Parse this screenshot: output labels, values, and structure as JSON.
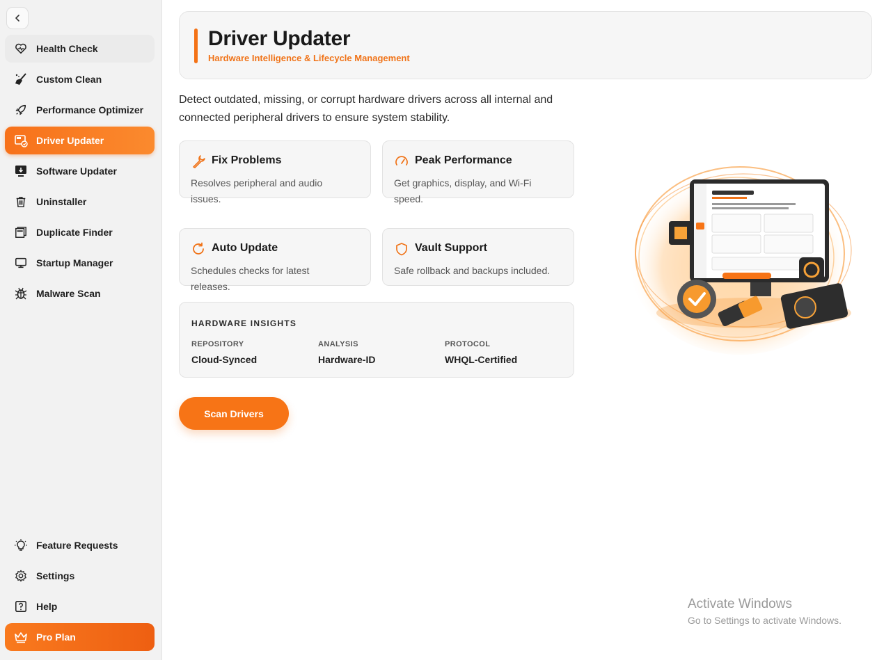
{
  "sidebar": {
    "top_items": [
      {
        "label": "Health Check",
        "icon": "heart-icon"
      },
      {
        "label": "Custom Clean",
        "icon": "broom-icon"
      },
      {
        "label": "Performance Optimizer",
        "icon": "rocket-icon"
      },
      {
        "label": "Driver Updater",
        "icon": "driver-icon",
        "active": true
      },
      {
        "label": "Software Updater",
        "icon": "monitor-download-icon"
      },
      {
        "label": "Uninstaller",
        "icon": "trash-icon"
      },
      {
        "label": "Duplicate Finder",
        "icon": "duplicate-icon"
      },
      {
        "label": "Startup Manager",
        "icon": "monitor-icon"
      },
      {
        "label": "Malware Scan",
        "icon": "bug-icon"
      }
    ],
    "bottom_items": [
      {
        "label": "Feature Requests",
        "icon": "lightbulb-icon"
      },
      {
        "label": "Settings",
        "icon": "gear-icon"
      },
      {
        "label": "Help",
        "icon": "help-icon"
      },
      {
        "label": "Pro Plan",
        "icon": "crown-icon"
      }
    ]
  },
  "header": {
    "title": "Driver Updater",
    "subtitle": "Hardware Intelligence & Lifecycle Management"
  },
  "description": "Detect outdated, missing, or corrupt hardware drivers across all internal and connected peripheral drivers to ensure system stability.",
  "features": [
    {
      "title": "Fix Problems",
      "desc": "Resolves peripheral and audio issues.",
      "icon": "wrench-icon"
    },
    {
      "title": "Peak Performance",
      "desc": "Get graphics, display, and Wi-Fi speed.",
      "icon": "gauge-icon"
    },
    {
      "title": "Auto Update",
      "desc": "Schedules checks for latest releases.",
      "icon": "refresh-icon"
    },
    {
      "title": "Vault Support",
      "desc": "Safe rollback and backups included.",
      "icon": "shield-icon"
    }
  ],
  "insights": {
    "title": "HARDWARE INSIGHTS",
    "items": [
      {
        "label": "REPOSITORY",
        "value": "Cloud-Synced"
      },
      {
        "label": "ANALYSIS",
        "value": "Hardware-ID"
      },
      {
        "label": "PROTOCOL",
        "value": "WHQL-Certified"
      }
    ]
  },
  "scan_button": "Scan Drivers",
  "watermark": {
    "line1": "Activate Windows",
    "line2": "Go to Settings to activate Windows."
  },
  "colors": {
    "accent": "#f77416",
    "sidebar_bg": "#f2f2f2",
    "card_bg": "#f6f6f6"
  }
}
